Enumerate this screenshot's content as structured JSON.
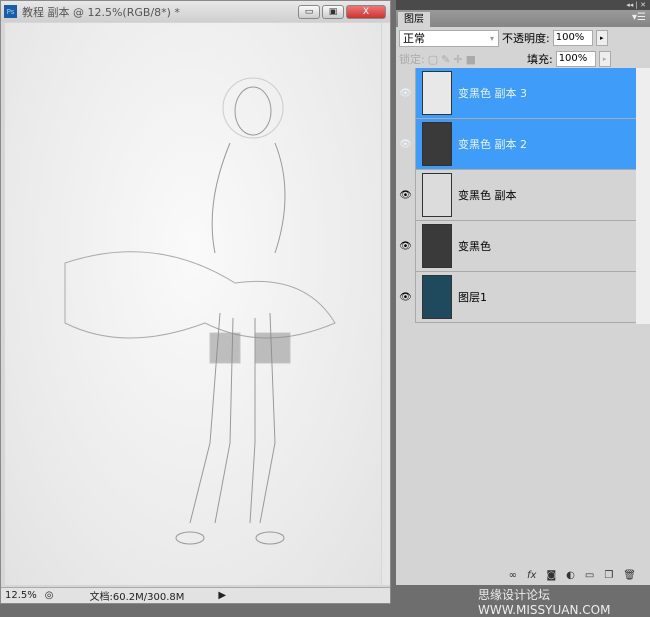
{
  "document": {
    "title": "教程 副本 @ 12.5%(RGB/8*) *",
    "zoom": "12.5%",
    "doc_size": "文档:60.2M/300.8M",
    "buttons": {
      "minimize": "▭",
      "restore": "▣",
      "close": "X"
    }
  },
  "panel": {
    "tab": "图层",
    "blend_mode": "正常",
    "opacity_label": "不透明度:",
    "opacity": "100%",
    "lock_label": "锁定:",
    "fill_label": "填充:",
    "fill": "100%",
    "layers": [
      {
        "name": "变黑色 副本 3",
        "selected": true,
        "thumb": "#e8e8e8"
      },
      {
        "name": "变黑色 副本 2",
        "selected": true,
        "thumb": "#3a3a3a"
      },
      {
        "name": "变黑色 副本",
        "selected": false,
        "thumb": "#dcdcdc"
      },
      {
        "name": "变黑色",
        "selected": false,
        "thumb": "#3a3a3a"
      },
      {
        "name": "图层1",
        "selected": false,
        "thumb": "#1f4a5e"
      }
    ]
  },
  "watermark": "思缘设计论坛 WWW.MISSYUAN.COM"
}
